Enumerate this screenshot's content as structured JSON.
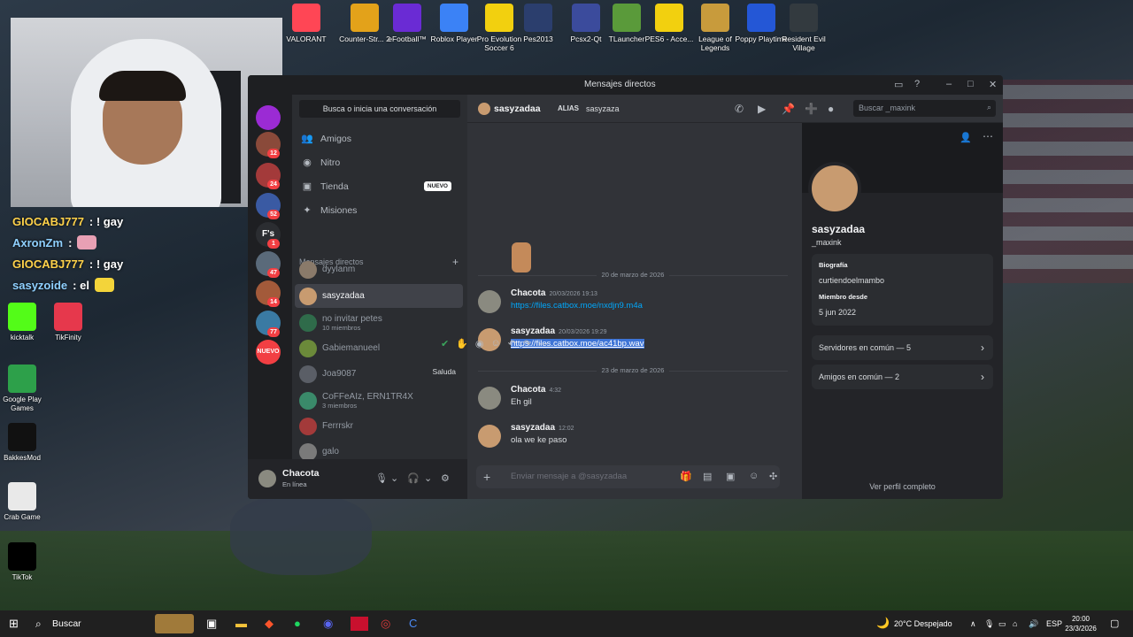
{
  "desktop": {
    "top_icons": [
      {
        "label": "VALORANT",
        "color": "#ff4655"
      },
      {
        "label": "Counter-Str... 2",
        "color": "#e3a21a"
      },
      {
        "label": "eFootball™",
        "color": "#6a2bd4"
      },
      {
        "label": "Roblox Player",
        "color": "#3b82f6"
      },
      {
        "label": "Pro Evolution Soccer 6",
        "color": "#f2d00f"
      },
      {
        "label": "Pes2013",
        "color": "#2b3e6d"
      },
      {
        "label": "Pcsx2-Qt",
        "color": "#3b4b9c"
      },
      {
        "label": "TLauncher",
        "color": "#5a9a3a"
      },
      {
        "label": "PES6 - Acce...",
        "color": "#f2d00f"
      },
      {
        "label": "League of Legends",
        "color": "#c89b3c"
      },
      {
        "label": "Poppy Playtime",
        "color": "#2457d6"
      },
      {
        "label": "Resident Evil Village",
        "color": "#333a3f"
      }
    ],
    "left_icons": [
      {
        "label": "kicktalk",
        "color": "#53fc18"
      },
      {
        "label": "TikFinity",
        "color": "#e6384c"
      },
      {
        "label": "Google Play Games",
        "color": "#2da04a"
      },
      {
        "label": "BakkesMod",
        "color": "#111111"
      },
      {
        "label": "Crab Game",
        "color": "#e9e9e9"
      },
      {
        "label": "TikTok",
        "color": "#000000"
      }
    ]
  },
  "stream_chat": [
    {
      "user": "GIOCABJ777",
      "msg": ": ! gay"
    },
    {
      "user": "AxronZm",
      "msg": ":"
    },
    {
      "user": "GIOCABJ777",
      "msg": ": ! gay"
    },
    {
      "user": "sasyzoide",
      "msg": ": el"
    }
  ],
  "discord": {
    "window_title": "Mensajes directos",
    "search_placeholder": "Busca o inicia una conversación",
    "nav": [
      {
        "icon": "friends-icon",
        "glyph": "👥",
        "label": "Amigos"
      },
      {
        "icon": "nitro-icon",
        "glyph": "◉",
        "label": "Nitro"
      },
      {
        "icon": "shop-icon",
        "glyph": "▣",
        "label": "Tienda",
        "badge": "NUEVO"
      },
      {
        "icon": "quests-icon",
        "glyph": "✦",
        "label": "Misiones"
      }
    ],
    "dm_section": "Mensajes directos",
    "dms": [
      {
        "name": "dyylanm",
        "sub": "",
        "color": "#8a7a6a"
      },
      {
        "name": "sasyzadaa",
        "sub": "",
        "color": "#c89b70",
        "selected": true
      },
      {
        "name": "no invitar petes",
        "sub": "10 miembros",
        "color": "#2f6b4a"
      },
      {
        "name": "Gabiemanueel",
        "sub": "",
        "color": "#6b8a3a"
      },
      {
        "name": "Joa9087",
        "sub": "",
        "color": "#5a5e66",
        "action": "Saluda"
      },
      {
        "name": "CoFFeAIz, ERN1TR4X",
        "sub": "3 miembros",
        "color": "#3a8a6a"
      },
      {
        "name": "Ferrrskr",
        "sub": "",
        "color": "#a33a3a"
      },
      {
        "name": "galo",
        "sub": "",
        "color": "#7a7a7a"
      }
    ],
    "servers": [
      {
        "color": "#9b2bd4",
        "badge": ""
      },
      {
        "color": "#8a4a3a",
        "badge": "12"
      },
      {
        "color": "#a33a3a",
        "badge": "24"
      },
      {
        "color": "#3a5aa3",
        "badge": "52"
      },
      {
        "color": "#2b2d31",
        "badge": "1",
        "text": "F's"
      },
      {
        "color": "#5a6a7a",
        "badge": "47"
      },
      {
        "color": "#a35a3a",
        "badge": "14"
      },
      {
        "color": "#3a7aa3",
        "badge": "77"
      },
      {
        "color": "#f23f43",
        "badge": "",
        "text": "NUEVO"
      }
    ],
    "user": {
      "name": "Chacota",
      "status": "En línea"
    },
    "header": {
      "name": "sasyzadaa",
      "alias_label": "ALIAS",
      "alias": "sasyzaza",
      "search_placeholder": "Buscar _maxink"
    },
    "messages": [
      {
        "type": "divider",
        "text": "20 de marzo de 2026"
      },
      {
        "type": "msg",
        "author": "Chacota",
        "time": "20/03/2026 19:13",
        "body": "https://files.catbox.moe/nxdjn9.m4a",
        "link": true,
        "color": "#8a8a80"
      },
      {
        "type": "msg",
        "author": "sasyzadaa",
        "time": "20/03/2026 19:29",
        "body": "https://files.catbox.moe/ac41bp.wav",
        "link": true,
        "selected": true,
        "color": "#c89b70"
      },
      {
        "type": "divider",
        "text": "23 de marzo de 2026"
      },
      {
        "type": "msg",
        "author": "Chacota",
        "time": "4:32",
        "body": "Eh gil",
        "color": "#8a8a80"
      },
      {
        "type": "msg",
        "author": "sasyzadaa",
        "time": "12:02",
        "body": "ola we ke paso",
        "color": "#c89b70"
      }
    ],
    "composer_placeholder": "Enviar mensaje a @sasyzadaa",
    "profile": {
      "name": "sasyzadaa",
      "handle": "_maxink",
      "bio_label": "Biografía",
      "bio": "curtiendoelmambo",
      "member_label": "Miembro desde",
      "member_since": "5 jun 2022",
      "servers_common": "Servidores en común — 5",
      "friends_common": "Amigos en común — 2",
      "full_profile": "Ver perfil completo"
    }
  },
  "taskbar": {
    "search": "Buscar",
    "weather": "20°C  Despejado",
    "lang": "ESP",
    "time": "20:00",
    "date": "23/3/2026"
  }
}
